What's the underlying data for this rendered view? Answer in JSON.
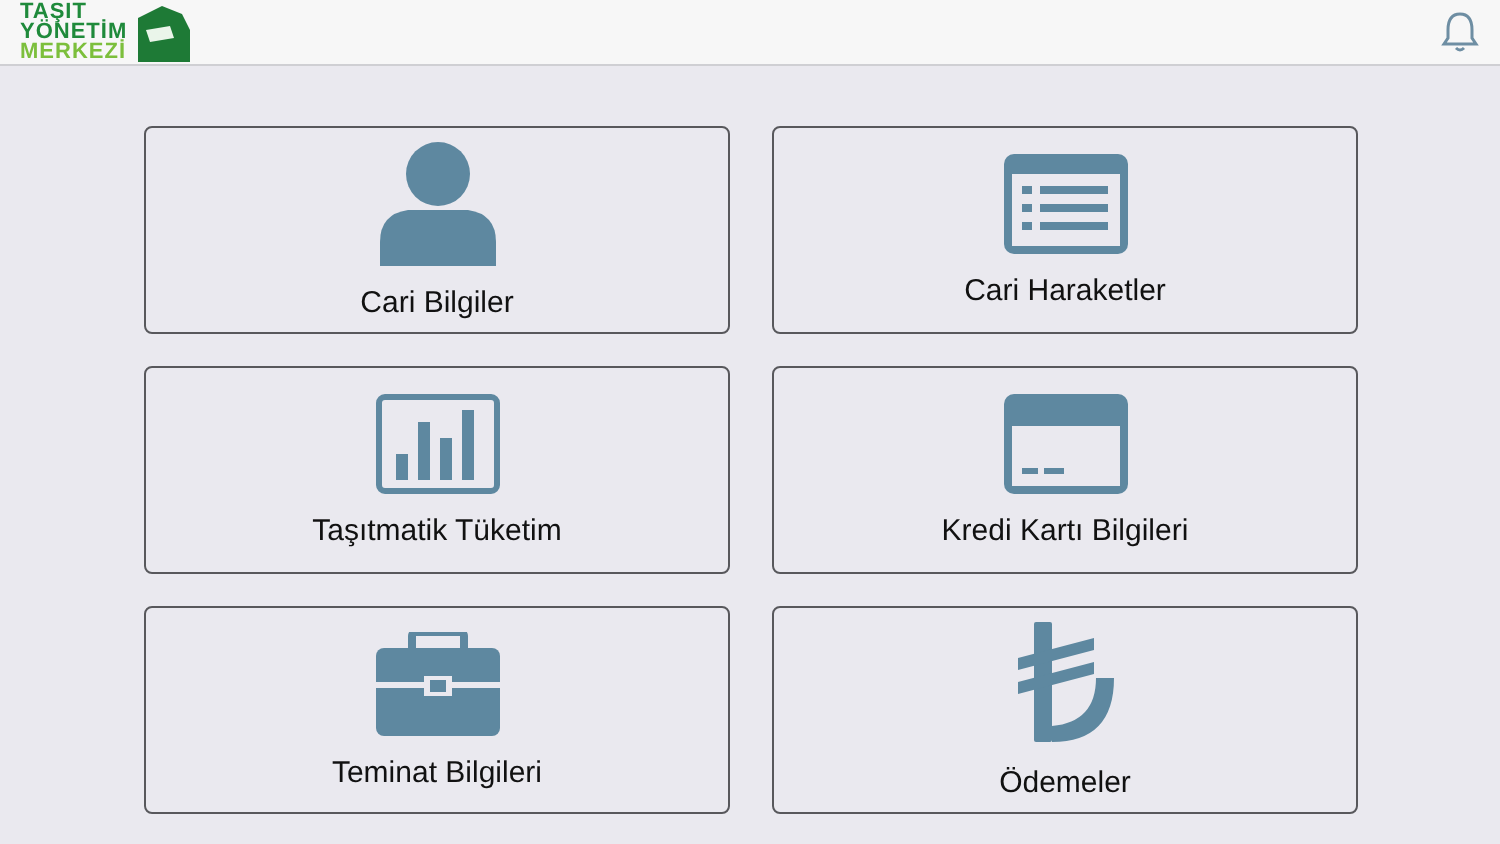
{
  "logo": {
    "lines": [
      "TAŞIT",
      "YÖNETİM",
      "MERKEZİ"
    ]
  },
  "tiles": [
    {
      "label": "Cari Bilgiler",
      "kind": "person"
    },
    {
      "label": "Cari Haraketler",
      "kind": "list"
    },
    {
      "label": "Taşıtmatik Tüketim",
      "kind": "chart"
    },
    {
      "label": "Kredi Kartı Bilgileri",
      "kind": "card"
    },
    {
      "label": "Teminat Bilgileri",
      "kind": "briefcase"
    },
    {
      "label": "Ödemeler",
      "kind": "lira"
    }
  ]
}
